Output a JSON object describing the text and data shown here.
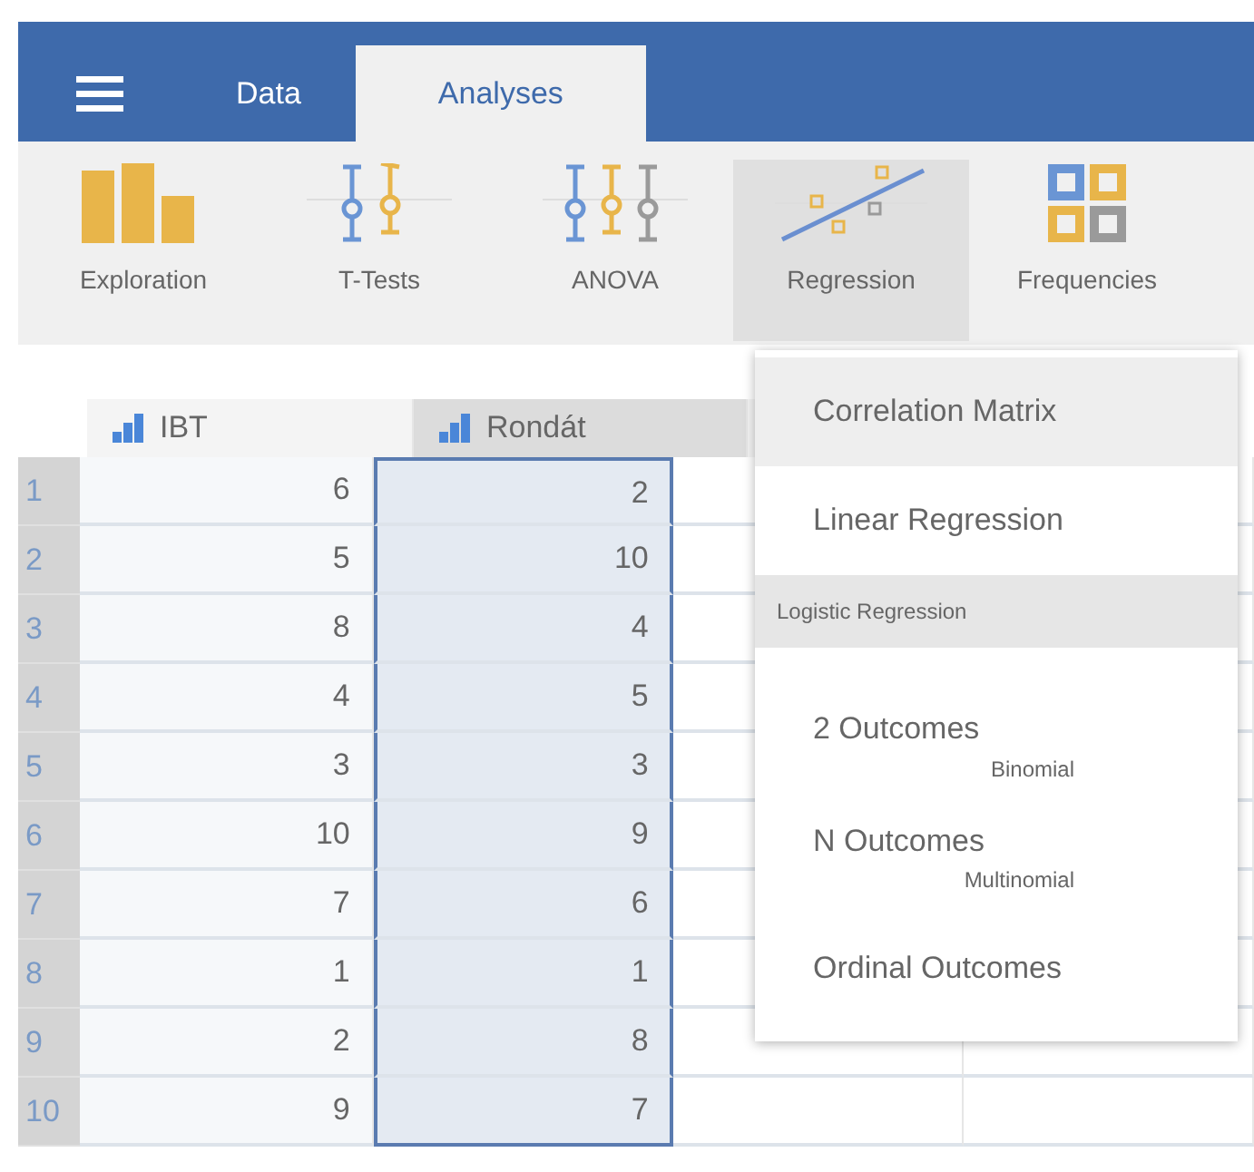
{
  "tabs": [
    {
      "label": "Data",
      "selected": false
    },
    {
      "label": "Analyses",
      "selected": true
    }
  ],
  "ribbon": [
    {
      "label": "Exploration",
      "selected": false
    },
    {
      "label": "T-Tests",
      "selected": false
    },
    {
      "label": "ANOVA",
      "selected": false
    },
    {
      "label": "Regression",
      "selected": true
    },
    {
      "label": "Frequencies",
      "selected": false
    }
  ],
  "sheet": {
    "columns": [
      {
        "name": "IBT",
        "selected": false
      },
      {
        "name": "Rondát",
        "selected": true
      }
    ],
    "rows": [
      [
        "1",
        "6",
        "2"
      ],
      [
        "2",
        "5",
        "10"
      ],
      [
        "3",
        "8",
        "4"
      ],
      [
        "4",
        "4",
        "5"
      ],
      [
        "5",
        "3",
        "3"
      ],
      [
        "6",
        "10",
        "9"
      ],
      [
        "7",
        "7",
        "6"
      ],
      [
        "8",
        "1",
        "1"
      ],
      [
        "9",
        "2",
        "8"
      ],
      [
        "10",
        "9",
        "7"
      ]
    ]
  },
  "menu": [
    {
      "kind": "item",
      "label": "Correlation Matrix",
      "highlighted": true
    },
    {
      "kind": "item",
      "label": "Linear Regression",
      "highlighted": false
    },
    {
      "kind": "header",
      "label": "Logistic Regression"
    },
    {
      "kind": "sub",
      "label": "2 Outcomes",
      "note": "Binomial",
      "highlighted": false
    },
    {
      "kind": "sub",
      "label": "N Outcomes",
      "note": "Multinomial",
      "highlighted": false
    },
    {
      "kind": "item",
      "label": "Ordinal Outcomes",
      "highlighted": false
    }
  ]
}
